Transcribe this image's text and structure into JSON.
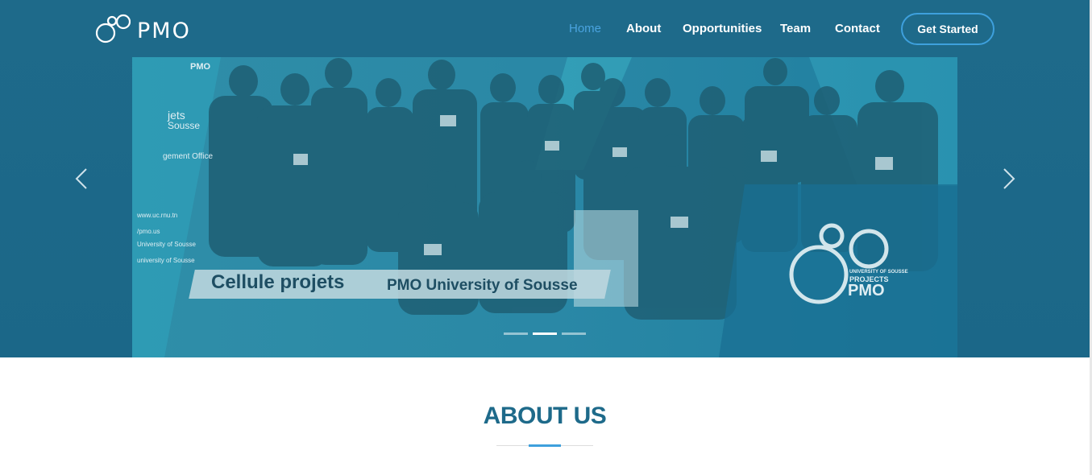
{
  "header": {
    "logo_text": "PMO",
    "nav": [
      {
        "label": "Home",
        "active": true
      },
      {
        "label": "About",
        "active": false
      },
      {
        "label": "Opportunities",
        "active": false
      },
      {
        "label": "Team",
        "active": false
      },
      {
        "label": "Contact",
        "active": false
      }
    ],
    "cta_label": "Get Started"
  },
  "carousel": {
    "caption_main": "Cellule projets",
    "caption_sub": "PMO University of Sousse",
    "badge": {
      "line1": "UNIVERSITY OF SOUSSE",
      "line2": "PROJECTS",
      "line3": "PMO"
    },
    "backdrop_text": {
      "corner_logo": "PMO",
      "jets": "jets",
      "sousse": "Sousse",
      "management": "gement Office",
      "web": "www.uc.rnu.tn",
      "fb": "/pmo.us",
      "univ1": "University of Sousse",
      "univ2": "university of Sousse"
    },
    "slide_count": 3,
    "active_slide": 2,
    "prev_icon": "chevron-left-icon",
    "next_icon": "chevron-right-icon"
  },
  "about": {
    "title": "ABOUT US"
  },
  "colors": {
    "header_bg": "#1e6a8a",
    "accent": "#3ea0dd",
    "title": "#1e6a8a"
  }
}
